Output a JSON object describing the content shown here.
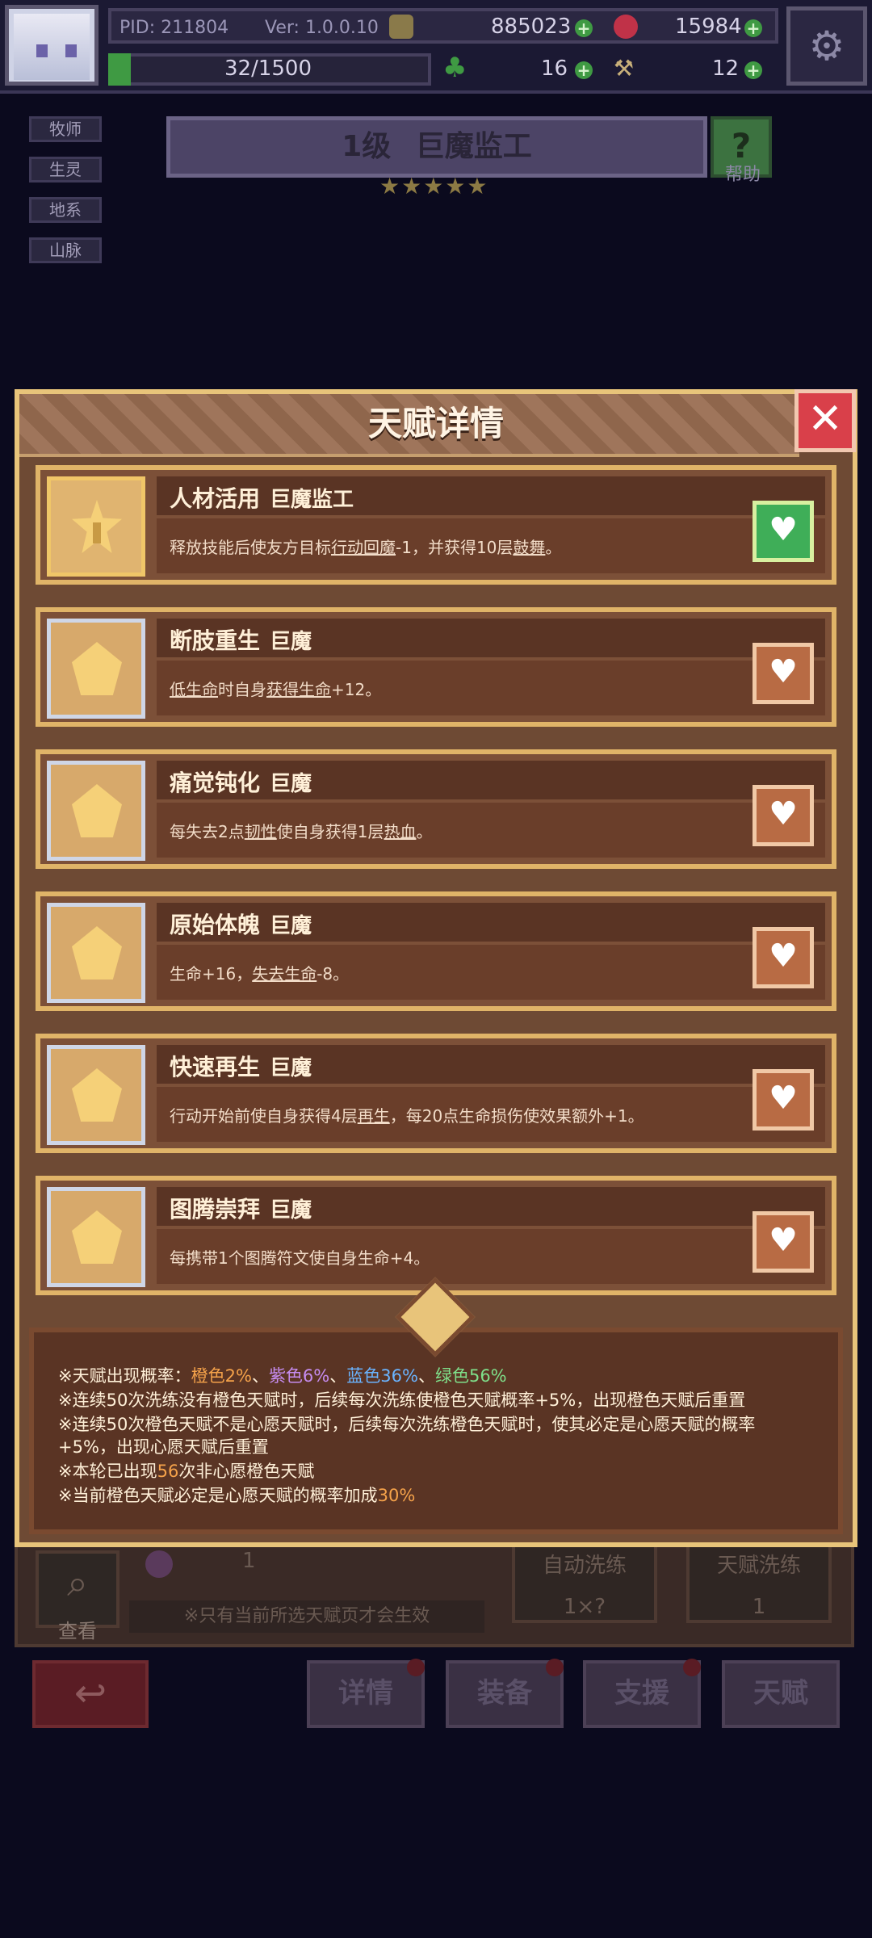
{
  "header": {
    "pid": "PID: 211804",
    "version": "Ver: 1.0.0.10",
    "coins": "885023",
    "gems": "15984",
    "stamina": "32/1500",
    "clover": "16",
    "shovel": "12"
  },
  "tags": [
    "牧师",
    "生灵",
    "地系",
    "山脉"
  ],
  "character": {
    "level": "1级",
    "name": "巨魔监工",
    "stars": "★★★★★",
    "help_label": "帮助"
  },
  "modal": {
    "title": "天赋详情",
    "talents": [
      {
        "name": "人材活用",
        "race": "巨魔监工",
        "desc_parts": [
          "释放技能后使友方目标",
          "行动回魔",
          "-1，并获得10层",
          "鼓舞",
          "。"
        ],
        "active": true
      },
      {
        "name": "断肢重生",
        "race": "巨魔",
        "desc_parts": [
          "",
          "低生命",
          "时自身",
          "获得生命",
          "+12。"
        ],
        "active": false
      },
      {
        "name": "痛觉钝化",
        "race": "巨魔",
        "desc_parts": [
          "每失去2点",
          "韧性",
          "使自身获得1层",
          "热血",
          "。"
        ],
        "active": false
      },
      {
        "name": "原始体魄",
        "race": "巨魔",
        "desc_parts": [
          "生命+16，",
          "失去生命",
          "-8。",
          "",
          ""
        ],
        "active": false
      },
      {
        "name": "快速再生",
        "race": "巨魔",
        "desc_parts": [
          "行动开始前使自身获得4层",
          "再生",
          "，每20点生命损伤使效果额外+1。",
          "",
          ""
        ],
        "active": false
      },
      {
        "name": "图腾崇拜",
        "race": "巨魔",
        "desc_parts": [
          "每携带1个图腾符文使自身生命+4。",
          "",
          "",
          "",
          ""
        ],
        "active": false
      }
    ],
    "info": {
      "line1_prefix": "※天赋出现概率：",
      "orange": "橙色2%",
      "purple": "紫色6%",
      "blue": "蓝色36%",
      "green": "绿色56%",
      "sep": "、",
      "line2": "※连续50次洗练没有橙色天赋时，后续每次洗练使橙色天赋概率+5%，出现橙色天赋后重置",
      "line3": "※连续50次橙色天赋不是心愿天赋时，后续每次洗练橙色天赋时，使其必定是心愿天赋的概率",
      "line4": "+5%，出现心愿天赋后重置",
      "line5_prefix": "※本轮已出现",
      "line5_num": "56",
      "line5_suffix": "次非心愿橙色天赋",
      "line6_prefix": "※当前橙色天赋必定是心愿天赋的概率加成",
      "line6_num": "30%"
    }
  },
  "underlay": {
    "look_label": "查看",
    "potion_count": "1",
    "note": "※只有当前所选天赋页才会生效",
    "auto_label": "自动洗练",
    "auto_cost": "1×?",
    "talent_wash_label": "天赋洗练",
    "talent_wash_cost": "1"
  },
  "nav": {
    "detail": "详情",
    "equip": "装备",
    "support": "支援",
    "talent": "天赋"
  },
  "colors": {
    "orange": "#f5a24a",
    "purple": "#c68cf0",
    "blue": "#6ab4ff",
    "green": "#7fe08a"
  }
}
